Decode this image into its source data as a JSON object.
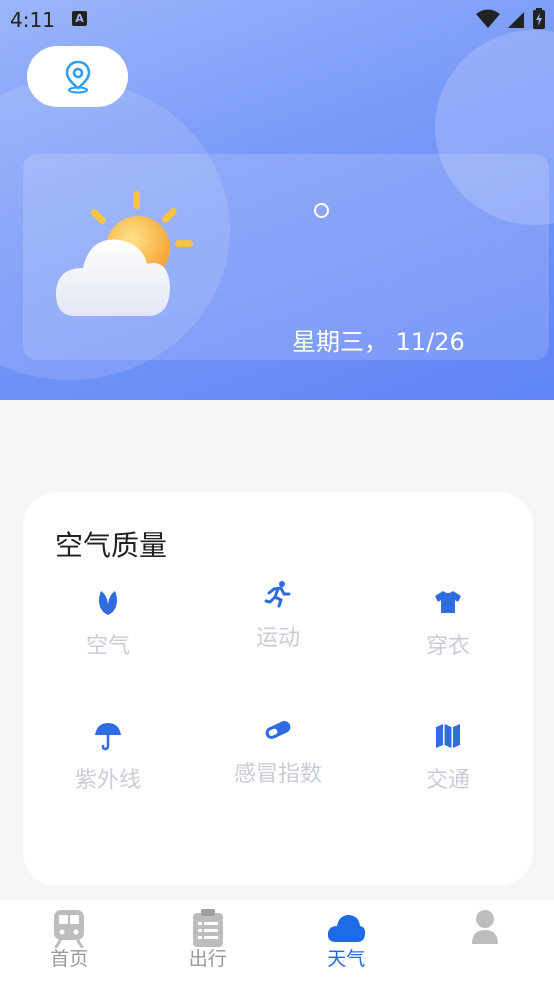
{
  "status_bar": {
    "time": "4:11",
    "notification_badge": "A"
  },
  "hero": {
    "date": "星期三， 11/26",
    "colors": {
      "accent": "#5f84f6",
      "sun": "#f6b93b"
    }
  },
  "air_quality": {
    "title": "空气质量",
    "items": [
      {
        "label": "空气",
        "icon": "leaf-icon"
      },
      {
        "label": "运动",
        "icon": "running-icon"
      },
      {
        "label": "穿衣",
        "icon": "shirt-icon"
      },
      {
        "label": "紫外线",
        "icon": "umbrella-icon"
      },
      {
        "label": "感冒指数",
        "icon": "pill-icon"
      },
      {
        "label": "交通",
        "icon": "map-icon"
      }
    ]
  },
  "nav": {
    "items": [
      {
        "label": "首页",
        "icon": "train-icon"
      },
      {
        "label": "出行",
        "icon": "clipboard-icon"
      },
      {
        "label": "天气",
        "icon": "cloud-icon",
        "active": true
      },
      {
        "label": "",
        "icon": "user-icon"
      }
    ]
  }
}
